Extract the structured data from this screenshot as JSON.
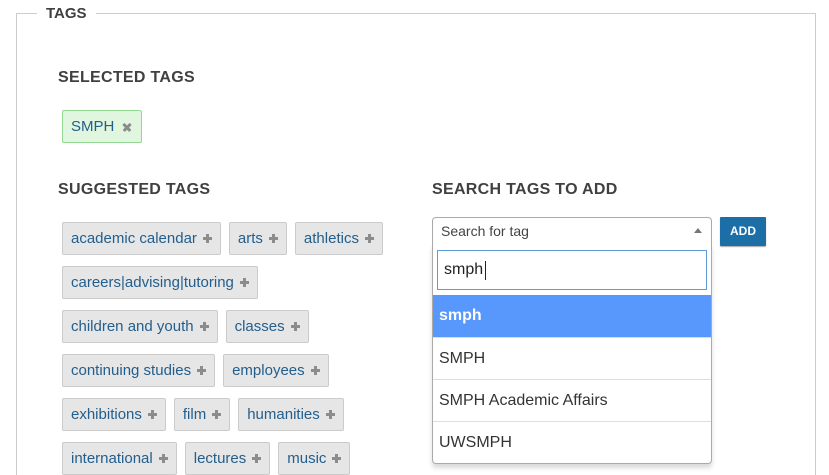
{
  "fieldset": {
    "legend": "TAGS"
  },
  "selected": {
    "heading": "SELECTED TAGS",
    "tags": [
      {
        "label": "SMPH"
      }
    ]
  },
  "suggested": {
    "heading": "SUGGESTED TAGS",
    "tags": [
      {
        "label": "academic calendar"
      },
      {
        "label": "arts"
      },
      {
        "label": "athletics"
      },
      {
        "label": "careers|advising|tutoring"
      },
      {
        "label": "children and youth"
      },
      {
        "label": "classes"
      },
      {
        "label": "continuing studies"
      },
      {
        "label": "employees"
      },
      {
        "label": "exhibitions"
      },
      {
        "label": "film"
      },
      {
        "label": "humanities"
      },
      {
        "label": "international"
      },
      {
        "label": "lectures"
      },
      {
        "label": "music"
      }
    ]
  },
  "search": {
    "heading": "SEARCH TAGS TO ADD",
    "select_placeholder": "Search for tag",
    "add_button_label": "ADD",
    "dropdown": {
      "query": "smph",
      "options": [
        {
          "label": "smph",
          "highlighted": true
        },
        {
          "label": "SMPH",
          "highlighted": false
        },
        {
          "label": "SMPH Academic Affairs",
          "highlighted": false
        },
        {
          "label": "UWSMPH",
          "highlighted": false
        }
      ]
    }
  },
  "icons": {
    "remove_selected_tag": "close-icon",
    "add_suggested_tag": "plus-icon",
    "select_toggle": "arrow-up-icon"
  },
  "colors": {
    "heading_text": "#404040",
    "tag_text": "#235e8c",
    "tag_background": "#e6e6e6",
    "tag_border": "#cbcbcb",
    "selected_tag_background": "#e1f6de",
    "selected_tag_border": "#93d893",
    "icon_gray": "#8c8c8c",
    "add_button_background": "#1c6ea6",
    "option_highlight": "#5897fb",
    "input_focus_border": "#5b9dd9"
  }
}
